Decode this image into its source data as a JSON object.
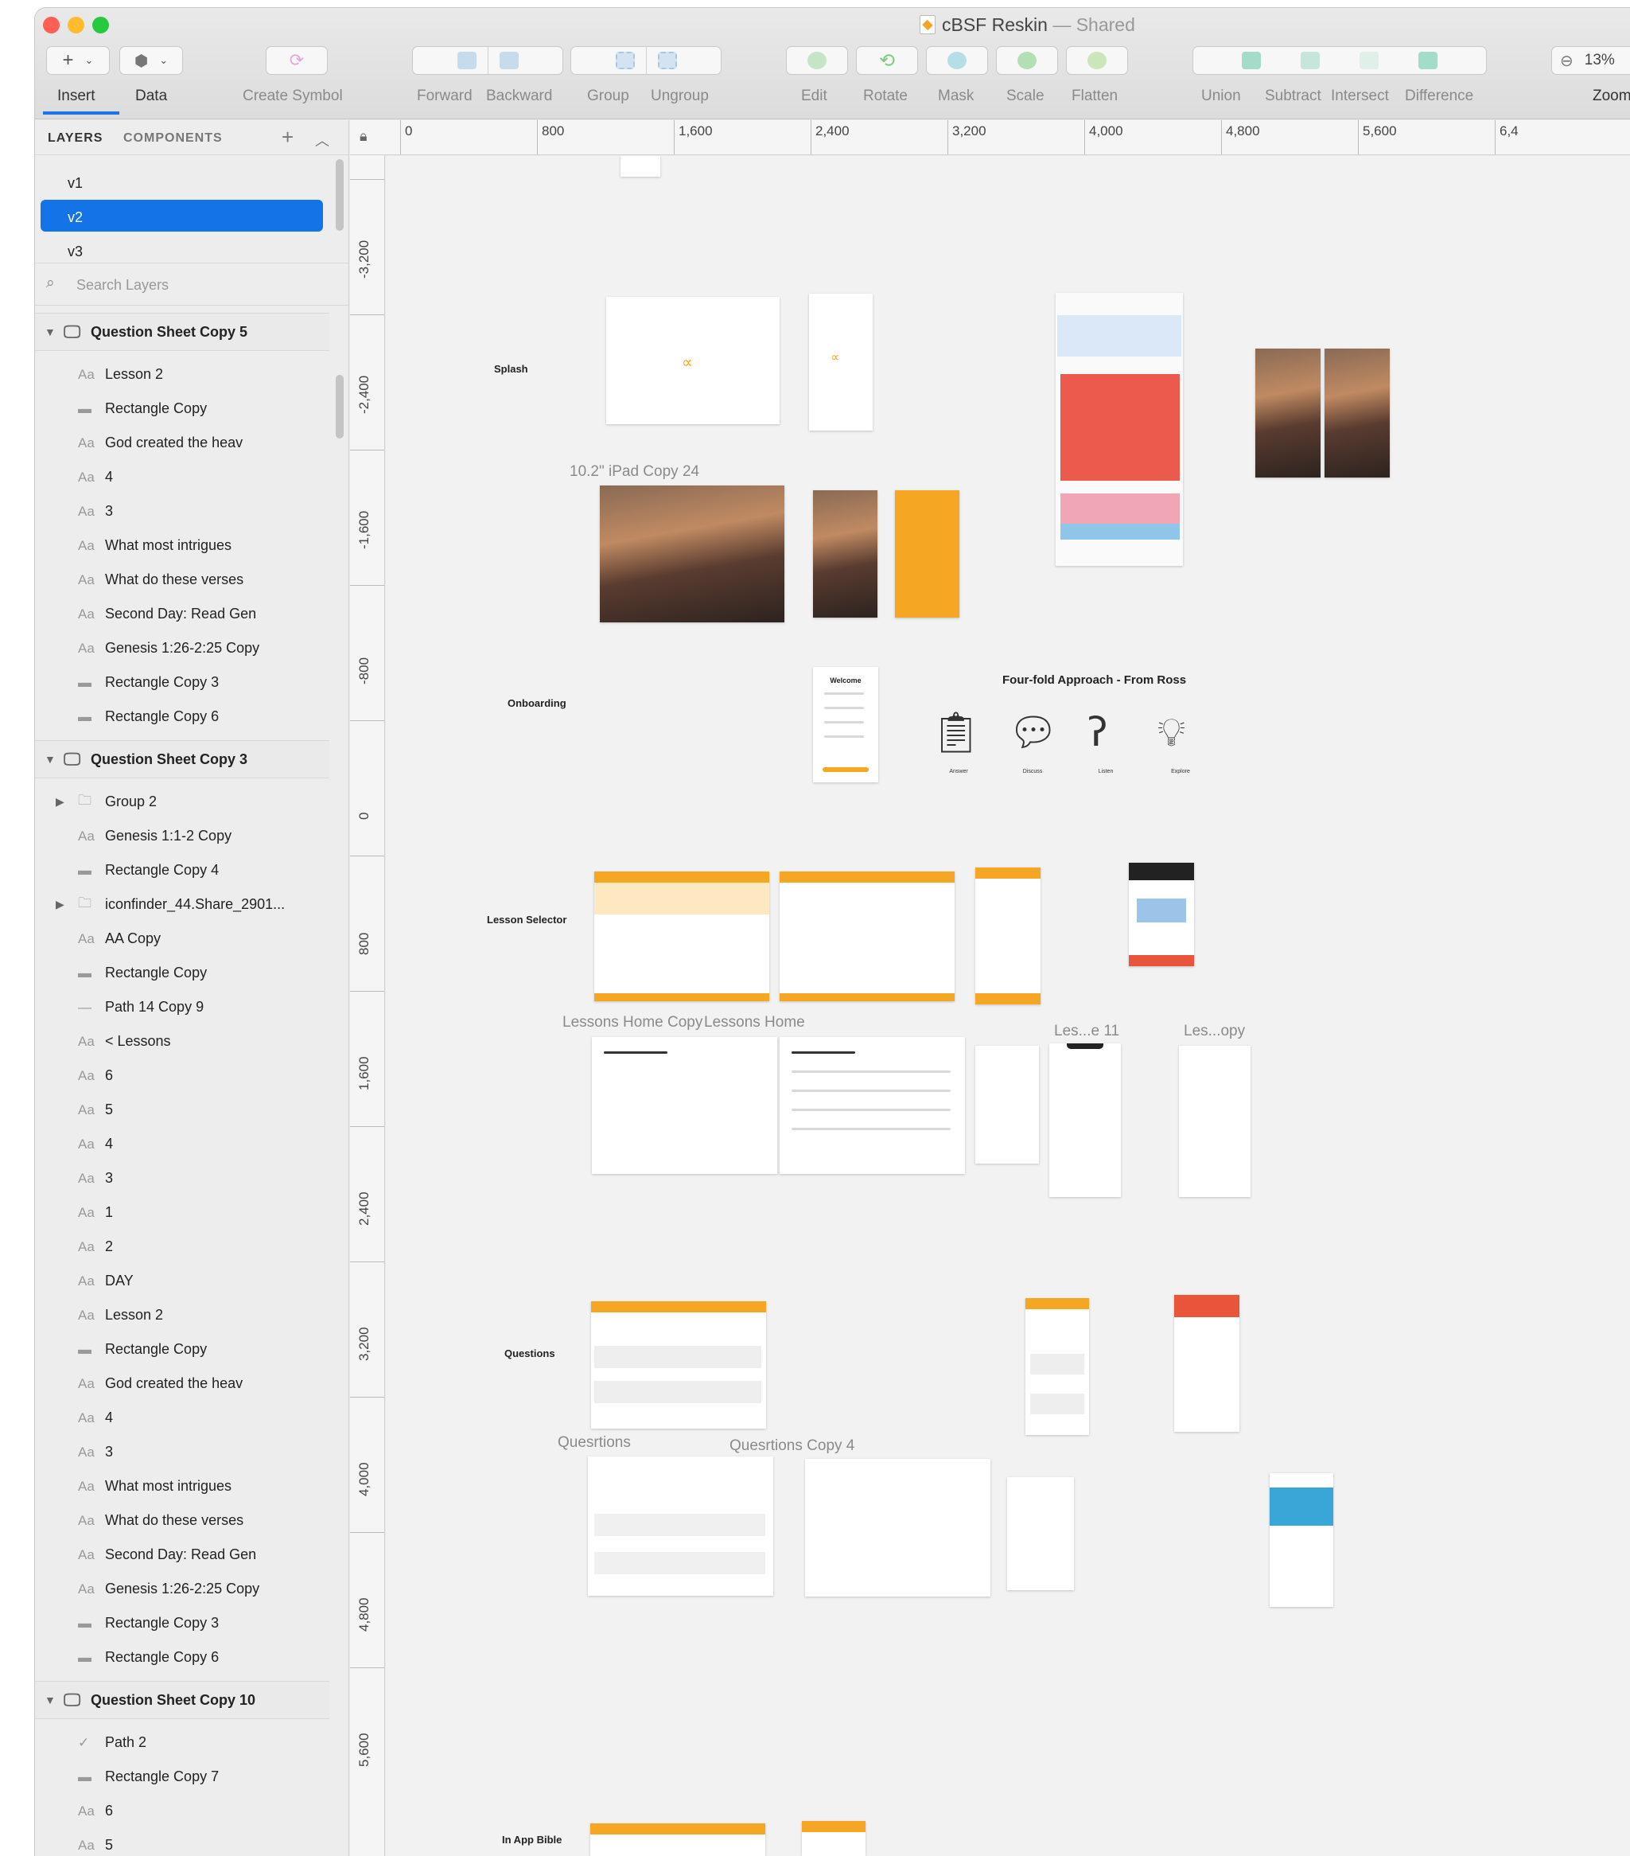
{
  "window": {
    "title": "cBSF Reskin",
    "title_suffix": "— Shared"
  },
  "toolbar": {
    "items": [
      "Insert",
      "Data",
      "Create Symbol",
      "Forward",
      "Backward",
      "Group",
      "Ungroup",
      "Edit",
      "Rotate",
      "Mask",
      "Scale",
      "Flatten",
      "Union",
      "Subtract",
      "Intersect",
      "Difference",
      "Zoom"
    ],
    "zoom_value": "13%"
  },
  "sidebar": {
    "tab_layers": "LAYERS",
    "tab_components": "COMPONENTS",
    "pages": [
      "v1",
      "v2",
      "v3"
    ],
    "selected_page": "v2",
    "search_placeholder": "Search Layers"
  },
  "layers": [
    {
      "type": "group",
      "label": "Question Sheet Copy 5"
    },
    {
      "type": "text",
      "label": "Lesson 2"
    },
    {
      "type": "rect",
      "label": "Rectangle Copy"
    },
    {
      "type": "text",
      "label": "God created the heav"
    },
    {
      "type": "text",
      "label": "4"
    },
    {
      "type": "text",
      "label": "3"
    },
    {
      "type": "text",
      "label": "What most intrigues"
    },
    {
      "type": "text",
      "label": "What do these verses"
    },
    {
      "type": "text",
      "label": "Second Day: Read Gen"
    },
    {
      "type": "text",
      "label": "Genesis 1:26-2:25 Copy"
    },
    {
      "type": "rect",
      "label": "Rectangle Copy 3"
    },
    {
      "type": "rect",
      "label": "Rectangle Copy 6"
    },
    {
      "type": "group",
      "label": "Question Sheet Copy 3"
    },
    {
      "type": "folder",
      "label": "Group 2"
    },
    {
      "type": "text",
      "label": "Genesis 1:1-2 Copy"
    },
    {
      "type": "rect",
      "label": "Rectangle Copy 4"
    },
    {
      "type": "folder",
      "label": "iconfinder_44.Share_2901..."
    },
    {
      "type": "text",
      "label": "AA Copy"
    },
    {
      "type": "rect",
      "label": "Rectangle Copy"
    },
    {
      "type": "path",
      "label": "Path 14 Copy 9"
    },
    {
      "type": "text",
      "label": "< Lessons"
    },
    {
      "type": "text",
      "label": "6"
    },
    {
      "type": "text",
      "label": "5"
    },
    {
      "type": "text",
      "label": "4"
    },
    {
      "type": "text",
      "label": "3"
    },
    {
      "type": "text",
      "label": "1"
    },
    {
      "type": "text",
      "label": "2"
    },
    {
      "type": "text",
      "label": "DAY"
    },
    {
      "type": "text",
      "label": "Lesson 2"
    },
    {
      "type": "rect",
      "label": "Rectangle Copy"
    },
    {
      "type": "text",
      "label": "God created the heav"
    },
    {
      "type": "text",
      "label": "4"
    },
    {
      "type": "text",
      "label": "3"
    },
    {
      "type": "text",
      "label": "What most intrigues"
    },
    {
      "type": "text",
      "label": "What do these verses"
    },
    {
      "type": "text",
      "label": "Second Day: Read Gen"
    },
    {
      "type": "text",
      "label": "Genesis 1:26-2:25 Copy"
    },
    {
      "type": "rect",
      "label": "Rectangle Copy 3"
    },
    {
      "type": "rect",
      "label": "Rectangle Copy 6"
    },
    {
      "type": "group",
      "label": "Question Sheet Copy 10"
    },
    {
      "type": "check",
      "label": "Path 2"
    },
    {
      "type": "rect",
      "label": "Rectangle Copy 7"
    },
    {
      "type": "text",
      "label": "6"
    },
    {
      "type": "text",
      "label": "5"
    }
  ],
  "ruler": {
    "h_ticks": [
      "0",
      "800",
      "1,600",
      "2,400",
      "3,200",
      "4,000",
      "4,800",
      "5,600",
      "6,4"
    ],
    "v_ticks": [
      "-3,200",
      "-2,400",
      "-1,600",
      "-800",
      "0",
      "800",
      "1,600",
      "2,400",
      "3,200",
      "4,000",
      "4,800",
      "5,600"
    ]
  },
  "canvas": {
    "sections": [
      "Splash",
      "Onboarding",
      "Lesson Selector",
      "Questions",
      "In App Bible"
    ],
    "artboard_labels": [
      "10.2\" iPad Copy 24",
      "Lessons Home Copy",
      "Lessons Home",
      "Les...e 11",
      "Les...opy",
      "Quesrtions",
      "Quesrtions Copy 4"
    ],
    "fourfold_title": "Four-fold Approach - From Ross",
    "fourfold_items": [
      "Answer",
      "Discuss",
      "Listen",
      "Explore"
    ],
    "welcome_title": "Welcome"
  },
  "colors": {
    "accent": "#1473e6",
    "orange": "#f5a623",
    "red": "#e8553b"
  },
  "icons": [
    "insert-icon",
    "data-icon",
    "symbol-icon",
    "forward-icon",
    "backward-icon",
    "group-icon",
    "ungroup-icon",
    "edit-icon",
    "rotate-icon",
    "mask-icon",
    "scale-icon",
    "flatten-icon",
    "union-icon",
    "subtract-icon",
    "intersect-icon",
    "difference-icon",
    "zoom-out-icon",
    "lock-icon",
    "search-icon",
    "plus-icon",
    "collapse-icon"
  ]
}
